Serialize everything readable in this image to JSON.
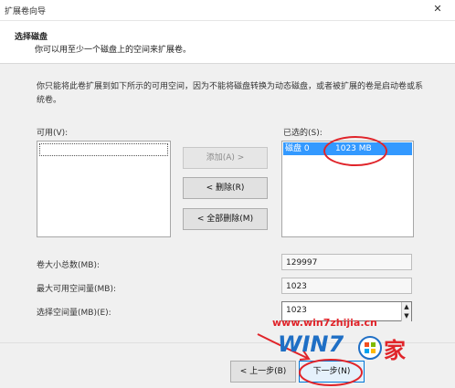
{
  "window": {
    "title": "扩展卷向导",
    "close_glyph": "✕"
  },
  "header": {
    "title": "选择磁盘",
    "subtitle": "你可以用至少一个磁盘上的空间来扩展卷。"
  },
  "description": "你只能将此卷扩展到如下所示的可用空间，因为不能将磁盘转换为动态磁盘，或者被扩展的卷是启动卷或系统卷。",
  "available": {
    "label": "可用(V):",
    "items": []
  },
  "selected": {
    "label": "已选的(S):",
    "items": [
      {
        "disk": "磁盘 0",
        "size": "1023 MB"
      }
    ]
  },
  "buttons": {
    "add": "添加(A) >",
    "remove": "< 删除(R)",
    "remove_all": "< 全部删除(M)"
  },
  "fields": {
    "total_label": "卷大小总数(MB):",
    "total_value": "129997",
    "max_label": "最大可用空间量(MB):",
    "max_value": "1023",
    "select_label": "选择空间量(MB)(E):",
    "select_value": "1023"
  },
  "footer": {
    "back": "< 上一步(B)",
    "next": "下一步(N)"
  },
  "watermark": {
    "url": "www.win7zhijia.cn",
    "brand": "WIN7",
    "brand_suffix": "家"
  },
  "colors": {
    "annotation": "#e0242a",
    "selection": "#3399ff",
    "watermark_red": "#e0242a",
    "watermark_blue": "#1f6fc5"
  }
}
